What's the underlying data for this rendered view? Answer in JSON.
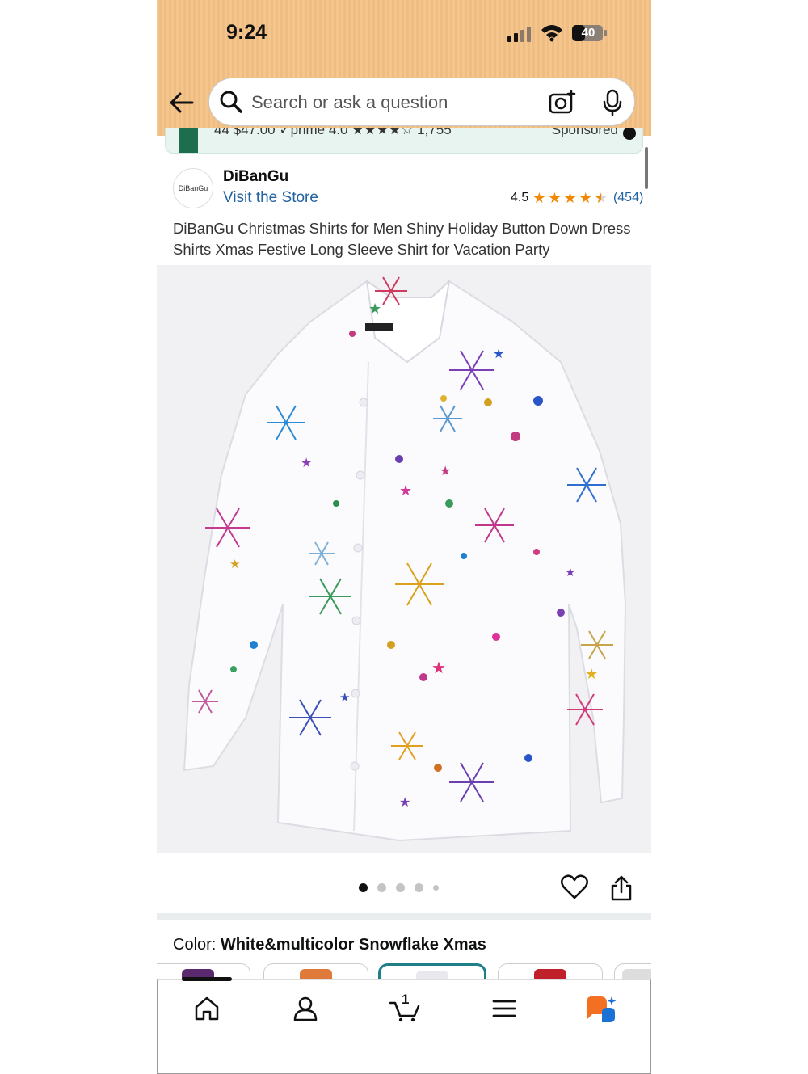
{
  "status_bar": {
    "time": "9:24",
    "battery": "40"
  },
  "search": {
    "placeholder": "Search or ask a question"
  },
  "sponsored_strip": {
    "text": "44  $47.00 ✓prime  4.0 ★★★★☆ 1,755",
    "sponsored_label": "Sponsored"
  },
  "brand": {
    "logo_text": "DiBanGu",
    "name": "DiBanGu",
    "visit_store": "Visit the Store"
  },
  "rating": {
    "value": "4.5",
    "stars": 4.5,
    "count": "(454)"
  },
  "product": {
    "title": "DiBanGu Christmas Shirts for Men Shiny Holiday Button Down Dress Shirts Xmas Festive Long Sleeve Shirt for Vacation Party"
  },
  "carousel": {
    "total_dots": 5,
    "active_index": 0
  },
  "color": {
    "label": "Color: ",
    "value": "White&multicolor Snowflake Xmas"
  },
  "swatches": [
    {
      "color": "#5b2a6e",
      "selected": false
    },
    {
      "color": "#e07a3a",
      "selected": false
    },
    {
      "color": "#e8e8ee",
      "selected": true
    },
    {
      "color": "#c0202a",
      "selected": false
    },
    {
      "color": "#dddddd",
      "selected": false
    }
  ],
  "bottom_nav": {
    "items": [
      "home-icon",
      "account-icon",
      "cart-icon",
      "menu-icon",
      "rufus-icon"
    ],
    "cart_count": "1"
  },
  "colors": {
    "header": "#f4c58c",
    "link": "#2162a1",
    "star": "#f08804",
    "swatch_selected": "#1f7f86"
  }
}
